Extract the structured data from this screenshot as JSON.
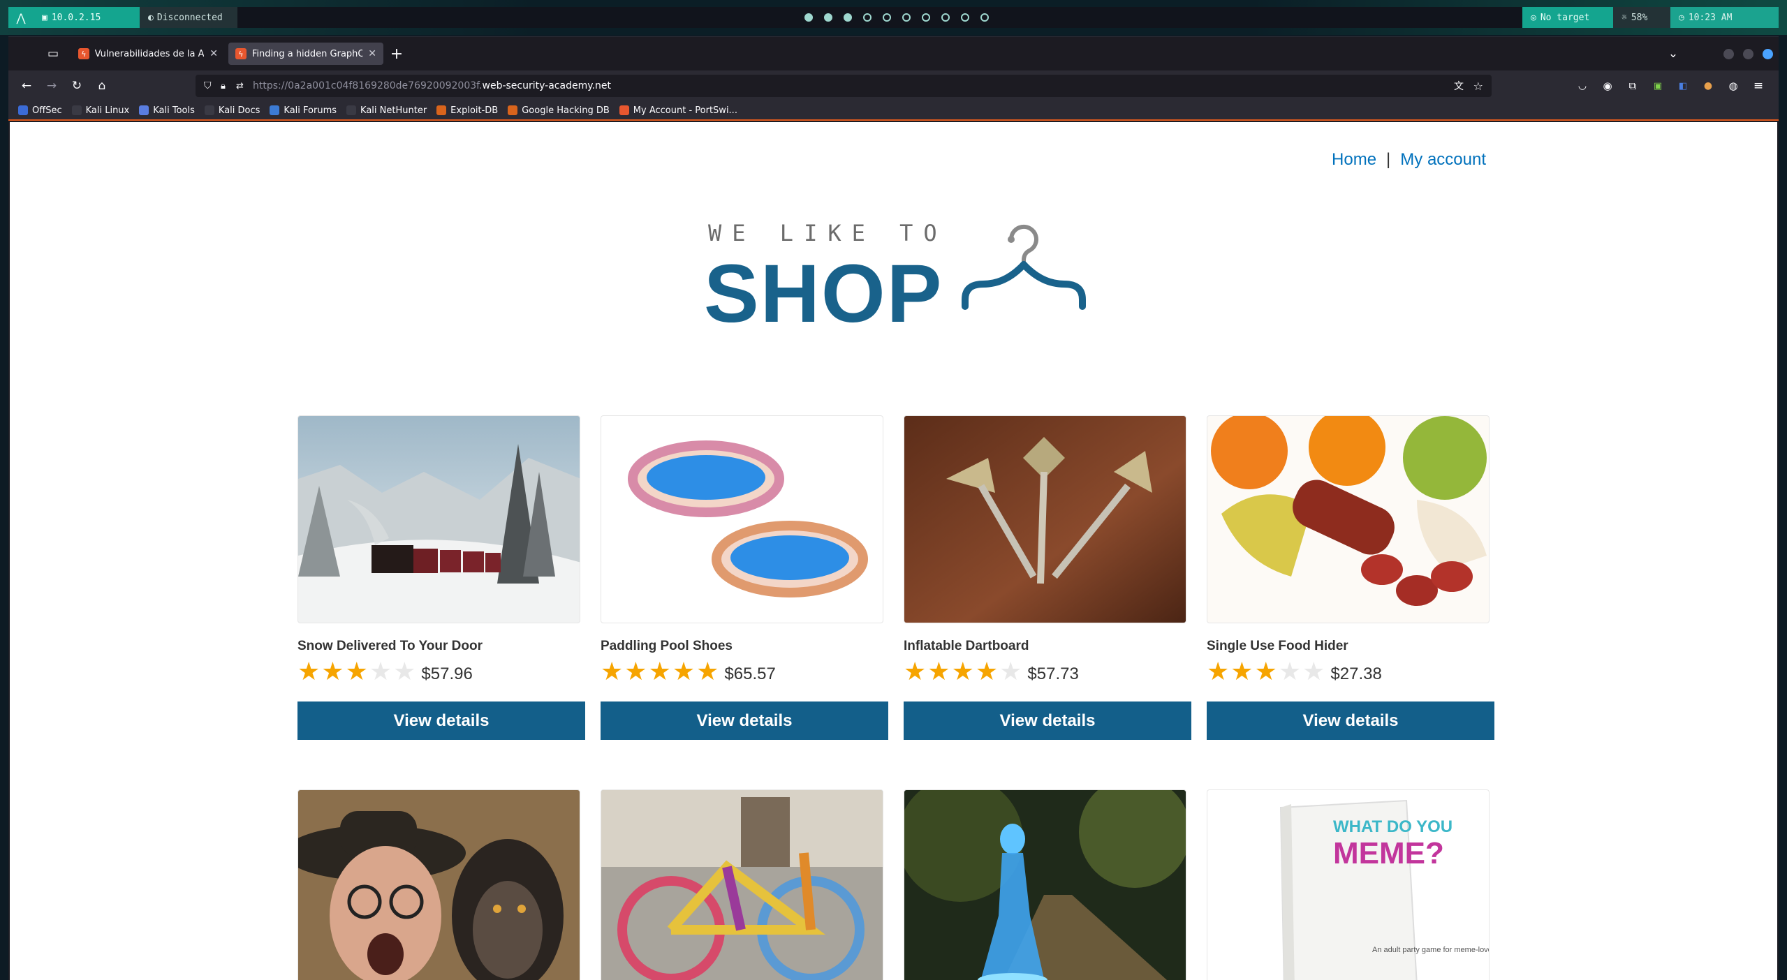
{
  "desktop": {
    "ip": "10.0.2.15",
    "vpn_status": "Disconnected",
    "target": "No target",
    "battery": "58%",
    "clock": "10:23 AM"
  },
  "browser": {
    "tabs": [
      {
        "title": "Vulnerabilidades de la API",
        "active": false
      },
      {
        "title": "Finding a hidden GraphQL",
        "active": true
      }
    ],
    "url_prefix": "https://0a2a001c04f8169280de76920092003f.",
    "url_domain": "web-security-academy.net",
    "bookmarks": [
      {
        "label": "OffSec",
        "color": "#3b6bd6"
      },
      {
        "label": "Kali Linux",
        "color": "#2a2a2a"
      },
      {
        "label": "Kali Tools",
        "color": "#5a7de0"
      },
      {
        "label": "Kali Docs",
        "color": "#2a2a2a"
      },
      {
        "label": "Kali Forums",
        "color": "#3c7bd4"
      },
      {
        "label": "Kali NetHunter",
        "color": "#2a2a2a"
      },
      {
        "label": "Exploit-DB",
        "color": "#d9641c"
      },
      {
        "label": "Google Hacking DB",
        "color": "#d9641c"
      },
      {
        "label": "My Account - PortSwi...",
        "color": "#e8572f"
      }
    ]
  },
  "site": {
    "nav": {
      "home": "Home",
      "separator": "|",
      "account": "My account"
    },
    "logo_line1": "WE LIKE TO",
    "logo_line2": "SHOP",
    "button_label": "View details",
    "products": [
      {
        "name": "Snow Delivered To Your Door",
        "rating": 3,
        "price": "$57.96"
      },
      {
        "name": "Paddling Pool Shoes",
        "rating": 5,
        "price": "$65.57"
      },
      {
        "name": "Inflatable Dartboard",
        "rating": 4,
        "price": "$57.73"
      },
      {
        "name": "Single Use Food Hider",
        "rating": 3,
        "price": "$27.38"
      },
      {
        "name": "",
        "rating": 0,
        "price": ""
      },
      {
        "name": "",
        "rating": 0,
        "price": ""
      },
      {
        "name": "",
        "rating": 0,
        "price": ""
      },
      {
        "name": "",
        "rating": 0,
        "price": ""
      }
    ],
    "meme_box": {
      "line1": "WHAT DO YOU",
      "line2": "MEME?",
      "tagline": "An adult party game for meme-lovers."
    }
  }
}
